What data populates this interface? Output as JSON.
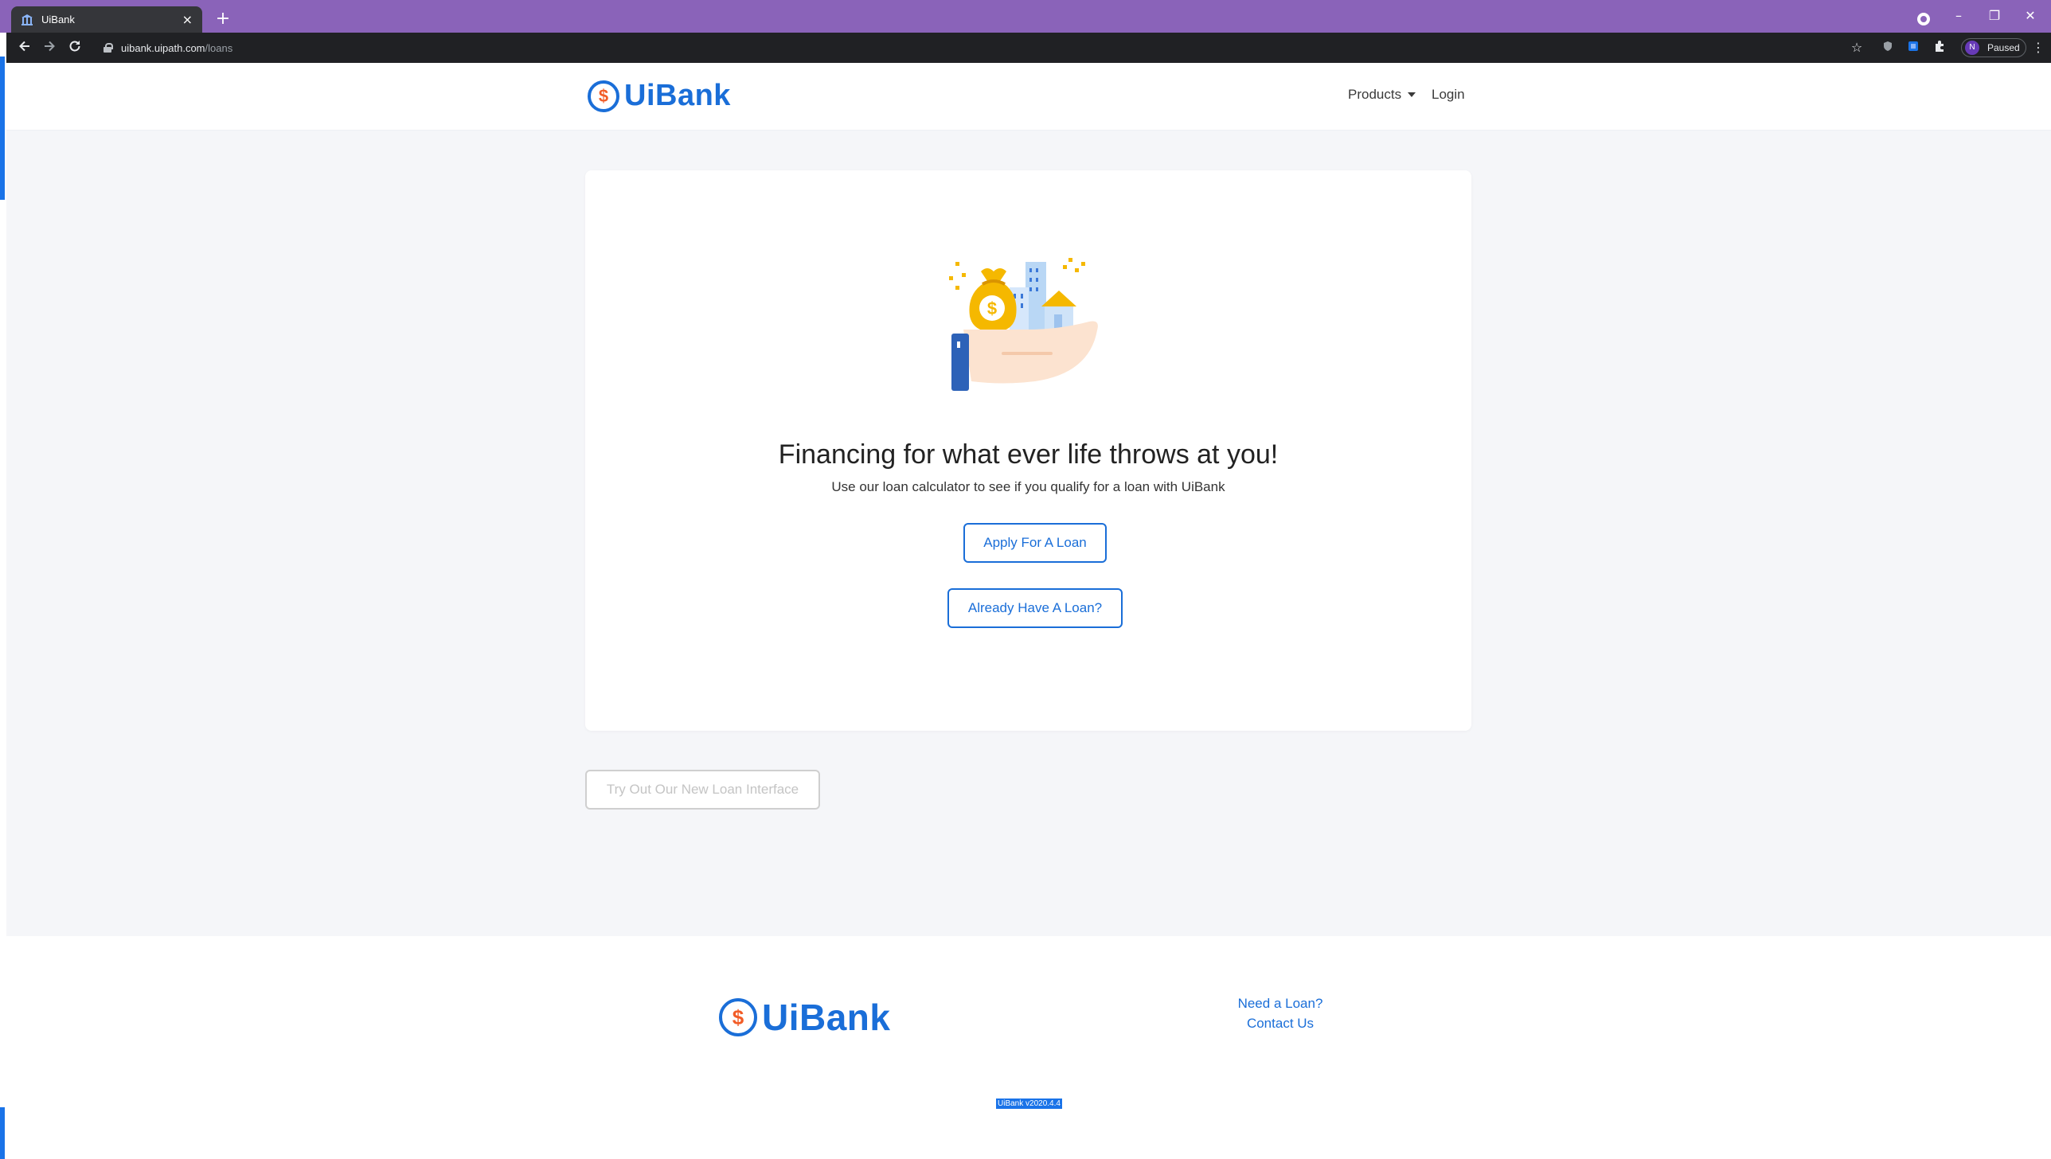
{
  "browser": {
    "tab_title": "UiBank",
    "tab_close": "×",
    "new_tab": "+",
    "url_host": "uibank.uipath.com",
    "url_path": "/loans",
    "profile_initial": "N",
    "profile_status": "Paused",
    "window_controls": [
      "–",
      "❐",
      "✕"
    ],
    "nav_icons": [
      "arrow-left-icon",
      "arrow-right-icon",
      "reload-icon"
    ]
  },
  "header": {
    "logo_symbol": "$",
    "logo_text": "UiBank",
    "nav_products": "Products",
    "nav_login": "Login"
  },
  "hero": {
    "headline": "Financing for what ever life throws at you!",
    "subtext": "Use our loan calculator to see if you qualify for a loan with UiBank",
    "apply_button": "Apply For A Loan",
    "existing_button": "Already Have A Loan?"
  },
  "secondary": {
    "try_button": "Try Out Our New Loan Interface"
  },
  "footer": {
    "logo_symbol": "$",
    "logo_text": "UiBank",
    "link_need_loan": "Need a Loan?",
    "link_contact": "Contact Us",
    "version": "UiBank v2020.4.4"
  },
  "colors": {
    "brand_blue": "#1a6ed8",
    "brand_orange": "#f25c27",
    "chrome_purple": "#8a63b9",
    "page_bg": "#f5f6f9"
  }
}
